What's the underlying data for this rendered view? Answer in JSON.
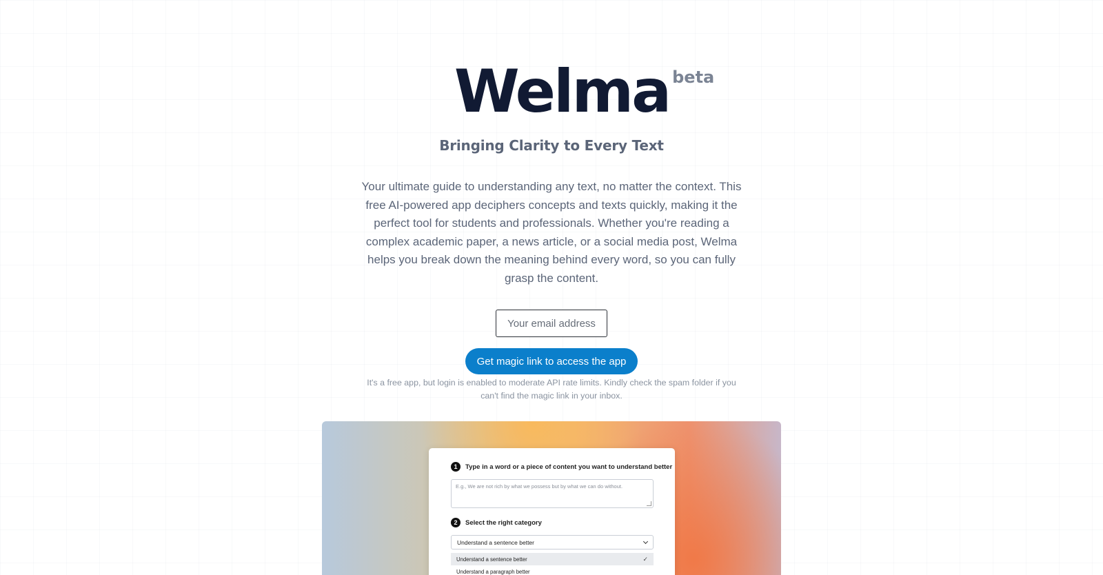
{
  "brand": {
    "name": "Welma",
    "badge": "beta"
  },
  "hero": {
    "tagline": "Bringing Clarity to Every Text",
    "description": "Your ultimate guide to understanding any text, no matter the context. This free AI-powered app deciphers concepts and texts quickly, making it the perfect tool for students and professionals. Whether you're reading a complex academic paper, a news article, or a social media post, Welma helps you break down the meaning behind every word, so you can fully grasp the content."
  },
  "signup": {
    "email_placeholder": "Your email address",
    "email_value": "",
    "submit_label": "Get magic link to access the app",
    "note": "It's a free app, but login is enabled to moderate API rate limits. Kindly check the spam folder if you can't find the magic link in your inbox."
  },
  "preview": {
    "step1": {
      "number": "1",
      "label": "Type in a word or a piece of content you want to understand better",
      "placeholder": "E.g., We are not rich by what we possess but by what we can do without."
    },
    "step2": {
      "number": "2",
      "label": "Select the right category",
      "selected": "Understand a sentence better",
      "options": [
        "Understand a sentence better",
        "Understand a paragraph better"
      ]
    }
  },
  "colors": {
    "accent": "#0b7fcb",
    "logo": "#111a33",
    "muted_text": "#5b6578"
  }
}
